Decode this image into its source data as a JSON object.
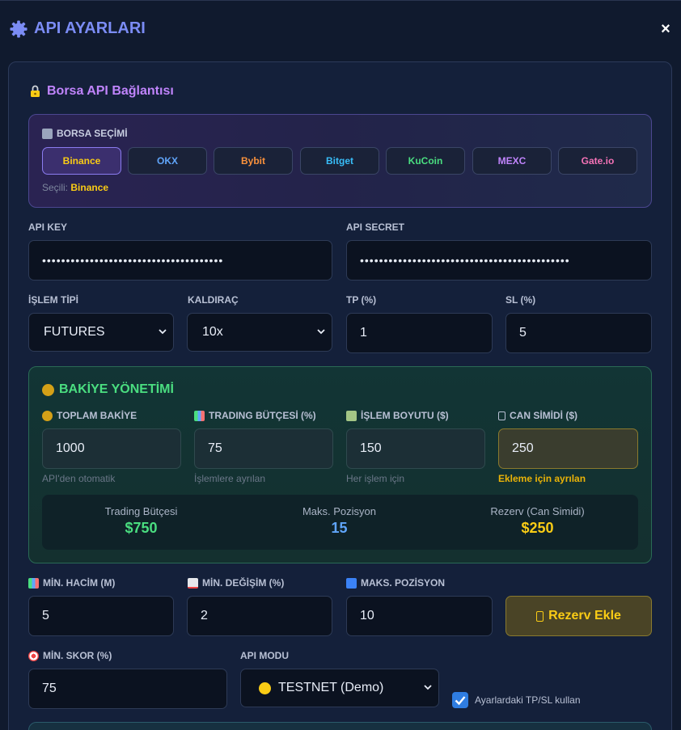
{
  "header": {
    "title": "API AYARLARI",
    "close_label": "×"
  },
  "connection": {
    "title": "Borsa API Bağlantısı",
    "exchange_label": "BORSA SEÇİMİ",
    "exchanges": [
      {
        "label": "Binance",
        "color": "#facc15"
      },
      {
        "label": "OKX",
        "color": "#60a5fa"
      },
      {
        "label": "Bybit",
        "color": "#fb923c"
      },
      {
        "label": "Bitget",
        "color": "#38bdf8"
      },
      {
        "label": "KuCoin",
        "color": "#4ade80"
      },
      {
        "label": "MEXC",
        "color": "#c084fc"
      },
      {
        "label": "Gate.io",
        "color": "#f472b6"
      }
    ],
    "selected_prefix": "Seçili:",
    "selected_value": "Binance"
  },
  "credentials": {
    "api_key_label": "API KEY",
    "api_key_value": "••••••••••••••••••••••••••••••••••••••",
    "api_secret_label": "API SECRET",
    "api_secret_value": "••••••••••••••••••••••••••••••••••••••••••••"
  },
  "trade": {
    "type_label": "İŞLEM TİPİ",
    "type_value": "FUTURES",
    "leverage_label": "KALDIRAÇ",
    "leverage_value": "10x",
    "tp_label": "TP (%)",
    "tp_value": "1",
    "sl_label": "SL (%)",
    "sl_value": "5"
  },
  "balance": {
    "title": "BAKİYE YÖNETİMİ",
    "total_label": "TOPLAM BAKİYE",
    "total_value": "1000",
    "total_hint": "API'den otomatik",
    "budget_label": "TRADING BÜTÇESİ (%)",
    "budget_value": "75",
    "budget_hint": "İşlemlere ayrılan",
    "size_label": "İŞLEM BOYUTU ($)",
    "size_value": "150",
    "size_hint": "Her işlem için",
    "reserve_label": "CAN SİMİDİ ($)",
    "reserve_value": "250",
    "reserve_hint": "Ekleme için ayrılan",
    "summary": [
      {
        "label": "Trading Bütçesi",
        "value": "$750",
        "color": "#4ade80"
      },
      {
        "label": "Maks. Pozisyon",
        "value": "15",
        "color": "#60a5fa"
      },
      {
        "label": "Rezerv (Can Simidi)",
        "value": "$250",
        "color": "#facc15"
      }
    ]
  },
  "filters": {
    "volume_label": "MİN. HACİM (M)",
    "volume_value": "5",
    "change_label": "MİN. DEĞİŞİM (%)",
    "change_value": "2",
    "maxpos_label": "MAKS. POZİSYON",
    "maxpos_value": "10",
    "reserve_button": "Rezerv Ekle",
    "score_label": "MİN. SKOR (%)",
    "score_value": "75",
    "mode_label": "API MODU",
    "mode_value": "TESTNET (Demo)",
    "tpsl_checkbox_label": "Ayarlardaki TP/SL kullan"
  }
}
